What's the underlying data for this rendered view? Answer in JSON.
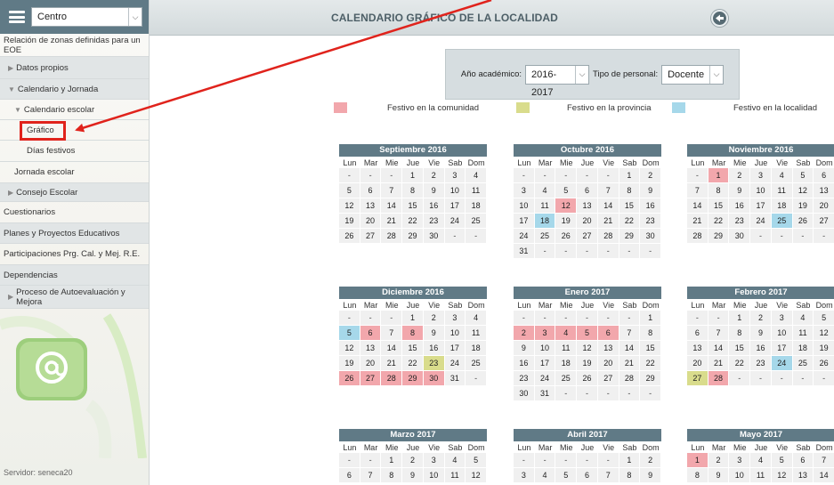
{
  "sidebar": {
    "centro_select": "Centro",
    "items": [
      {
        "label": "Relación de zonas definidas para un EOE",
        "level": 0,
        "arrow": "",
        "shade": false
      },
      {
        "label": "Datos propios",
        "level": 1,
        "arrow": "▶",
        "shade": true
      },
      {
        "label": "Calendario y Jornada",
        "level": 1,
        "arrow": "▼",
        "shade": true
      },
      {
        "label": "Calendario escolar",
        "level": 2,
        "arrow": "▼",
        "shade": false
      },
      {
        "label": "Gráfico",
        "level": 3,
        "arrow": "",
        "shade": false
      },
      {
        "label": "Días festivos",
        "level": 3,
        "arrow": "",
        "shade": false
      },
      {
        "label": "Jornada escolar",
        "level": 2,
        "arrow": "",
        "shade": false
      },
      {
        "label": "Consejo Escolar",
        "level": 1,
        "arrow": "▶",
        "shade": true
      },
      {
        "label": "Cuestionarios",
        "level": 0,
        "arrow": "",
        "shade": false
      },
      {
        "label": "Planes y Proyectos Educativos",
        "level": 0,
        "arrow": "",
        "shade": true
      },
      {
        "label": "Participaciones Prg. Cal. y Mej. R.E.",
        "level": 0,
        "arrow": "",
        "shade": false
      },
      {
        "label": "Dependencias",
        "level": 0,
        "arrow": "",
        "shade": true
      },
      {
        "label": "Proceso de Autoevaluación y Mejora",
        "level": 1,
        "arrow": "▶",
        "shade": true
      }
    ],
    "server": "Servidor: seneca20"
  },
  "header": {
    "title": "CALENDARIO GRÁFICO DE LA LOCALIDAD"
  },
  "filters": {
    "year_label": "Año académico:",
    "year_value": "2016-2017",
    "staff_label": "Tipo de personal:",
    "staff_value": "Docente"
  },
  "legend": [
    {
      "label": "Festivo en la comunidad",
      "color": "#f2a7ac"
    },
    {
      "label": "Festivo en la provincia",
      "color": "#d9dc8c"
    },
    {
      "label": "Festivo en la localidad",
      "color": "#a6d8ea"
    }
  ],
  "weekdays": [
    "Lun",
    "Mar",
    "Mie",
    "Jue",
    "Vie",
    "Sab",
    "Dom"
  ],
  "months": [
    {
      "title": "Septiembre 2016",
      "rows": [
        [
          "-",
          "-",
          "-",
          "1",
          "2",
          "3",
          "4"
        ],
        [
          "5",
          "6",
          "7",
          "8",
          "9",
          "10",
          "11"
        ],
        [
          "12",
          "13",
          "14",
          "15",
          "16",
          "17",
          "18"
        ],
        [
          "19",
          "20",
          "21",
          "22",
          "23",
          "24",
          "25"
        ],
        [
          "26",
          "27",
          "28",
          "29",
          "30",
          "-",
          "-"
        ]
      ],
      "hc": [],
      "hp": [],
      "hl": []
    },
    {
      "title": "Octubre 2016",
      "rows": [
        [
          "-",
          "-",
          "-",
          "-",
          "-",
          "1",
          "2"
        ],
        [
          "3",
          "4",
          "5",
          "6",
          "7",
          "8",
          "9"
        ],
        [
          "10",
          "11",
          "12",
          "13",
          "14",
          "15",
          "16"
        ],
        [
          "17",
          "18",
          "19",
          "20",
          "21",
          "22",
          "23"
        ],
        [
          "24",
          "25",
          "26",
          "27",
          "28",
          "29",
          "30"
        ],
        [
          "31",
          "-",
          "-",
          "-",
          "-",
          "-",
          "-"
        ]
      ],
      "hc": [
        "12"
      ],
      "hp": [],
      "hl": [
        "18"
      ]
    },
    {
      "title": "Noviembre 2016",
      "rows": [
        [
          "-",
          "1",
          "2",
          "3",
          "4",
          "5",
          "6"
        ],
        [
          "7",
          "8",
          "9",
          "10",
          "11",
          "12",
          "13"
        ],
        [
          "14",
          "15",
          "16",
          "17",
          "18",
          "19",
          "20"
        ],
        [
          "21",
          "22",
          "23",
          "24",
          "25",
          "26",
          "27"
        ],
        [
          "28",
          "29",
          "30",
          "-",
          "-",
          "-",
          "-"
        ]
      ],
      "hc": [
        "1"
      ],
      "hp": [],
      "hl": [
        "25"
      ]
    },
    {
      "title": "Diciembre 2016",
      "rows": [
        [
          "-",
          "-",
          "-",
          "1",
          "2",
          "3",
          "4"
        ],
        [
          "5",
          "6",
          "7",
          "8",
          "9",
          "10",
          "11"
        ],
        [
          "12",
          "13",
          "14",
          "15",
          "16",
          "17",
          "18"
        ],
        [
          "19",
          "20",
          "21",
          "22",
          "23",
          "24",
          "25"
        ],
        [
          "26",
          "27",
          "28",
          "29",
          "30",
          "31",
          "-"
        ]
      ],
      "hc": [
        "6",
        "8",
        "26",
        "27",
        "28",
        "29",
        "30"
      ],
      "hp": [
        "23"
      ],
      "hl": [
        "5"
      ]
    },
    {
      "title": "Enero 2017",
      "rows": [
        [
          "-",
          "-",
          "-",
          "-",
          "-",
          "-",
          "1"
        ],
        [
          "2",
          "3",
          "4",
          "5",
          "6",
          "7",
          "8"
        ],
        [
          "9",
          "10",
          "11",
          "12",
          "13",
          "14",
          "15"
        ],
        [
          "16",
          "17",
          "18",
          "19",
          "20",
          "21",
          "22"
        ],
        [
          "23",
          "24",
          "25",
          "26",
          "27",
          "28",
          "29"
        ],
        [
          "30",
          "31",
          "-",
          "-",
          "-",
          "-",
          "-"
        ]
      ],
      "hc": [
        "2",
        "3",
        "4",
        "5",
        "6"
      ],
      "hp": [],
      "hl": []
    },
    {
      "title": "Febrero 2017",
      "rows": [
        [
          "-",
          "-",
          "1",
          "2",
          "3",
          "4",
          "5"
        ],
        [
          "6",
          "7",
          "8",
          "9",
          "10",
          "11",
          "12"
        ],
        [
          "13",
          "14",
          "15",
          "16",
          "17",
          "18",
          "19"
        ],
        [
          "20",
          "21",
          "22",
          "23",
          "24",
          "25",
          "26"
        ],
        [
          "27",
          "28",
          "-",
          "-",
          "-",
          "-",
          "-"
        ]
      ],
      "hc": [
        "28"
      ],
      "hp": [
        "27"
      ],
      "hl": [
        "24"
      ]
    },
    {
      "title": "Marzo 2017",
      "rows": [
        [
          "-",
          "-",
          "1",
          "2",
          "3",
          "4",
          "5"
        ],
        [
          "6",
          "7",
          "8",
          "9",
          "10",
          "11",
          "12"
        ]
      ],
      "hc": [],
      "hp": [],
      "hl": []
    },
    {
      "title": "Abril 2017",
      "rows": [
        [
          "-",
          "-",
          "-",
          "-",
          "-",
          "1",
          "2"
        ],
        [
          "3",
          "4",
          "5",
          "6",
          "7",
          "8",
          "9"
        ]
      ],
      "hc": [],
      "hp": [],
      "hl": []
    },
    {
      "title": "Mayo 2017",
      "rows": [
        [
          "1",
          "2",
          "3",
          "4",
          "5",
          "6",
          "7"
        ],
        [
          "8",
          "9",
          "10",
          "11",
          "12",
          "13",
          "14"
        ]
      ],
      "hc": [
        "1"
      ],
      "hp": [],
      "hl": []
    }
  ]
}
